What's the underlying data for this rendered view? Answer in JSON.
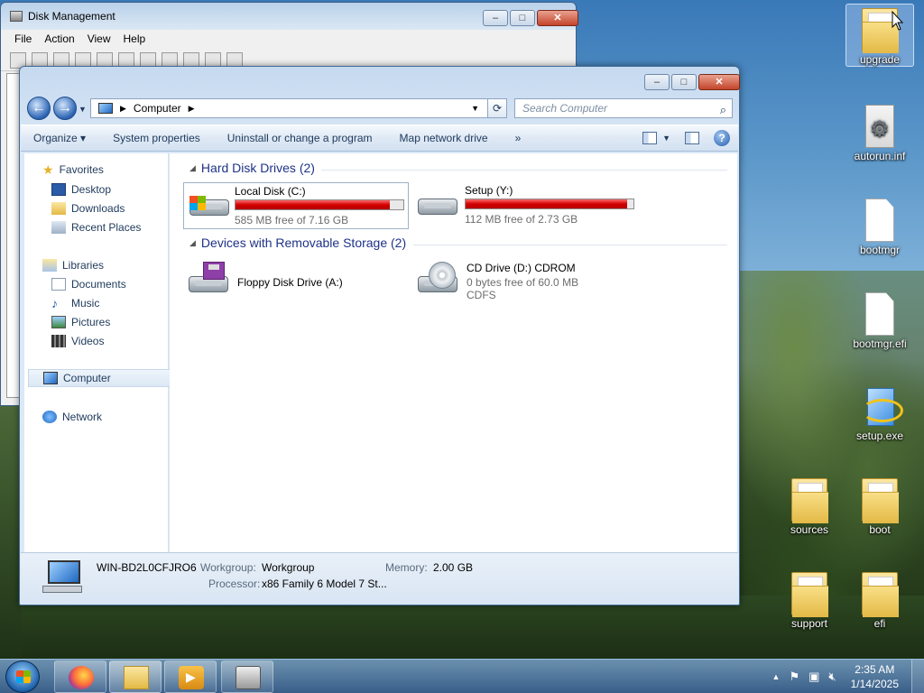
{
  "desktop": {
    "icons": [
      {
        "label": "upgrade"
      },
      {
        "label": "autorun.inf"
      },
      {
        "label": "bootmgr"
      },
      {
        "label": "bootmgr.efi"
      },
      {
        "label": "setup.exe"
      },
      {
        "label": "sources"
      },
      {
        "label": "boot"
      },
      {
        "label": "support"
      },
      {
        "label": "efi"
      }
    ]
  },
  "disk_management": {
    "title": "Disk Management",
    "menu": [
      "File",
      "Action",
      "View",
      "Help"
    ]
  },
  "explorer": {
    "address": {
      "location": "Computer"
    },
    "search_placeholder": "Search Computer",
    "commands": [
      "Organize",
      "System properties",
      "Uninstall or change a program",
      "Map network drive"
    ],
    "more_commands": "»",
    "nav": {
      "favorites": "Favorites",
      "desktop": "Desktop",
      "downloads": "Downloads",
      "recent_places": "Recent Places",
      "libraries": "Libraries",
      "documents": "Documents",
      "music": "Music",
      "pictures": "Pictures",
      "videos": "Videos",
      "computer": "Computer",
      "network": "Network"
    },
    "groups": {
      "hdd": "Hard Disk Drives (2)",
      "removable": "Devices with Removable Storage (2)"
    },
    "drives": {
      "c": {
        "name": "Local Disk (C:)",
        "free": "585 MB free of 7.16 GB",
        "used_fraction": 0.92
      },
      "y": {
        "name": "Setup (Y:)",
        "free": "112 MB free of 2.73 GB",
        "used_fraction": 0.96
      },
      "a": {
        "name": "Floppy Disk Drive (A:)"
      },
      "d": {
        "name": "CD Drive (D:) CDROM",
        "free": "0 bytes free of 60.0 MB",
        "fs": "CDFS"
      }
    },
    "details": {
      "computer_name": "WIN-BD2L0CFJRO6",
      "workgroup_label": "Workgroup:",
      "workgroup": "Workgroup",
      "memory_label": "Memory:",
      "memory": "2.00 GB",
      "processor_label": "Processor:",
      "processor": "x86 Family 6 Model 7 St..."
    }
  },
  "taskbar": {
    "time": "2:35 AM",
    "date": "1/14/2025"
  }
}
